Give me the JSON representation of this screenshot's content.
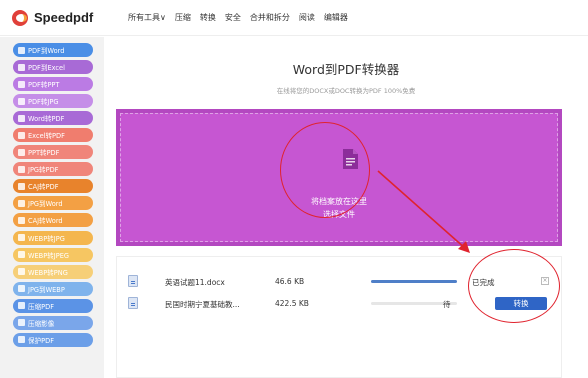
{
  "logo": {
    "text": "Speedpdf"
  },
  "nav": [
    "所有工具∨",
    "压缩",
    "转换",
    "安全",
    "合并和拆分",
    "阅读",
    "编辑器"
  ],
  "sidebar": {
    "items": [
      {
        "label": "PDF到Word",
        "color": "#4a8ee6"
      },
      {
        "label": "PDF到Excel",
        "color": "#a86ad6"
      },
      {
        "label": "PDF转PPT",
        "color": "#bb7be4"
      },
      {
        "label": "PDF转JPG",
        "color": "#c58ee8"
      },
      {
        "label": "Word转PDF",
        "color": "#a86ad6"
      },
      {
        "label": "Excel转PDF",
        "color": "#f07d6e"
      },
      {
        "label": "PPT转PDF",
        "color": "#f0857a"
      },
      {
        "label": "JPG转PDF",
        "color": "#f0857a"
      },
      {
        "label": "CAJ转PDF",
        "color": "#e8832c"
      },
      {
        "label": "JPG到Word",
        "color": "#f3a044"
      },
      {
        "label": "CAJ转Word",
        "color": "#f3a044"
      },
      {
        "label": "WEBP转JPG",
        "color": "#f4b64e"
      },
      {
        "label": "WEBP转JPEG",
        "color": "#f6c662"
      },
      {
        "label": "WEBP转PNG",
        "color": "#f6cf78"
      },
      {
        "label": "JPG到WEBP",
        "color": "#7fb3ec"
      },
      {
        "label": "压缩PDF",
        "color": "#5b93e6"
      },
      {
        "label": "压缩影像",
        "color": "#7aa6ea"
      },
      {
        "label": "保护PDF",
        "color": "#6c9fe8"
      }
    ]
  },
  "main": {
    "title": "Word到PDF转换器",
    "subtitle": "在线将您的DOCX或DOC转换为PDF 100%免费",
    "dropzone": {
      "drop_text": "将档案放在这里",
      "select_text": "选择文件"
    }
  },
  "files": [
    {
      "name": "英语试题11.docx",
      "size": "46.6 KB",
      "progress": 1.0,
      "status": "已完成",
      "action": ""
    },
    {
      "name": "民国时期宁夏基础教...",
      "size": "422.5 KB",
      "progress": 0.0,
      "status": "待",
      "action": "转换"
    }
  ],
  "colors": {
    "accent": "#2f65c6",
    "dropzone": "#c656d2",
    "annotation_red": "#e0232e"
  }
}
